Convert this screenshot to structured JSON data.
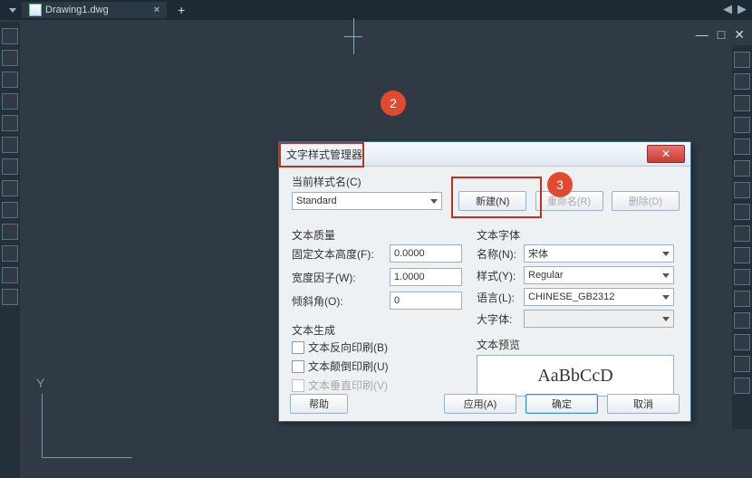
{
  "tabbar": {
    "active_tab": "Drawing1.dwg",
    "close_glyph": "×",
    "plus_glyph": "+"
  },
  "ext_controls": {
    "left": "◀",
    "right": "▶"
  },
  "win_controls": {
    "min": "—",
    "max": "□",
    "close": "✕"
  },
  "ucs": {
    "y": "Y"
  },
  "badges": {
    "b2": "2",
    "b3": "3"
  },
  "dialog": {
    "title": "文字样式管理器",
    "close_glyph": "✕",
    "current_style_label": "当前样式名(C)",
    "current_style_value": "Standard",
    "btn_new": "新建(N)",
    "btn_rename": "重命名(R)",
    "btn_delete": "删除(D)",
    "measure_title": "文本质量",
    "fixed_height_label": "固定文本高度(F):",
    "fixed_height_value": "0.0000",
    "width_factor_label": "宽度因子(W):",
    "width_factor_value": "1.0000",
    "oblique_label": "倾斜角(O):",
    "oblique_value": "0",
    "gen_title": "文本生成",
    "chk_backward": "文本反向印刷(B)",
    "chk_upsidedown": "文本颠倒印刷(U)",
    "chk_vertical": "文本垂直印刷(V)",
    "font_title": "文本字体",
    "font_name_label": "名称(N):",
    "font_name_value": "宋体",
    "font_style_label": "样式(Y):",
    "font_style_value": "Regular",
    "font_lang_label": "语言(L):",
    "font_lang_value": "CHINESE_GB2312",
    "bigfont_label": "大字体:",
    "preview_title": "文本预览",
    "preview_text": "AaBbCcD",
    "btn_help": "帮助",
    "btn_apply": "应用(A)",
    "btn_ok": "确定",
    "btn_cancel": "取消"
  }
}
